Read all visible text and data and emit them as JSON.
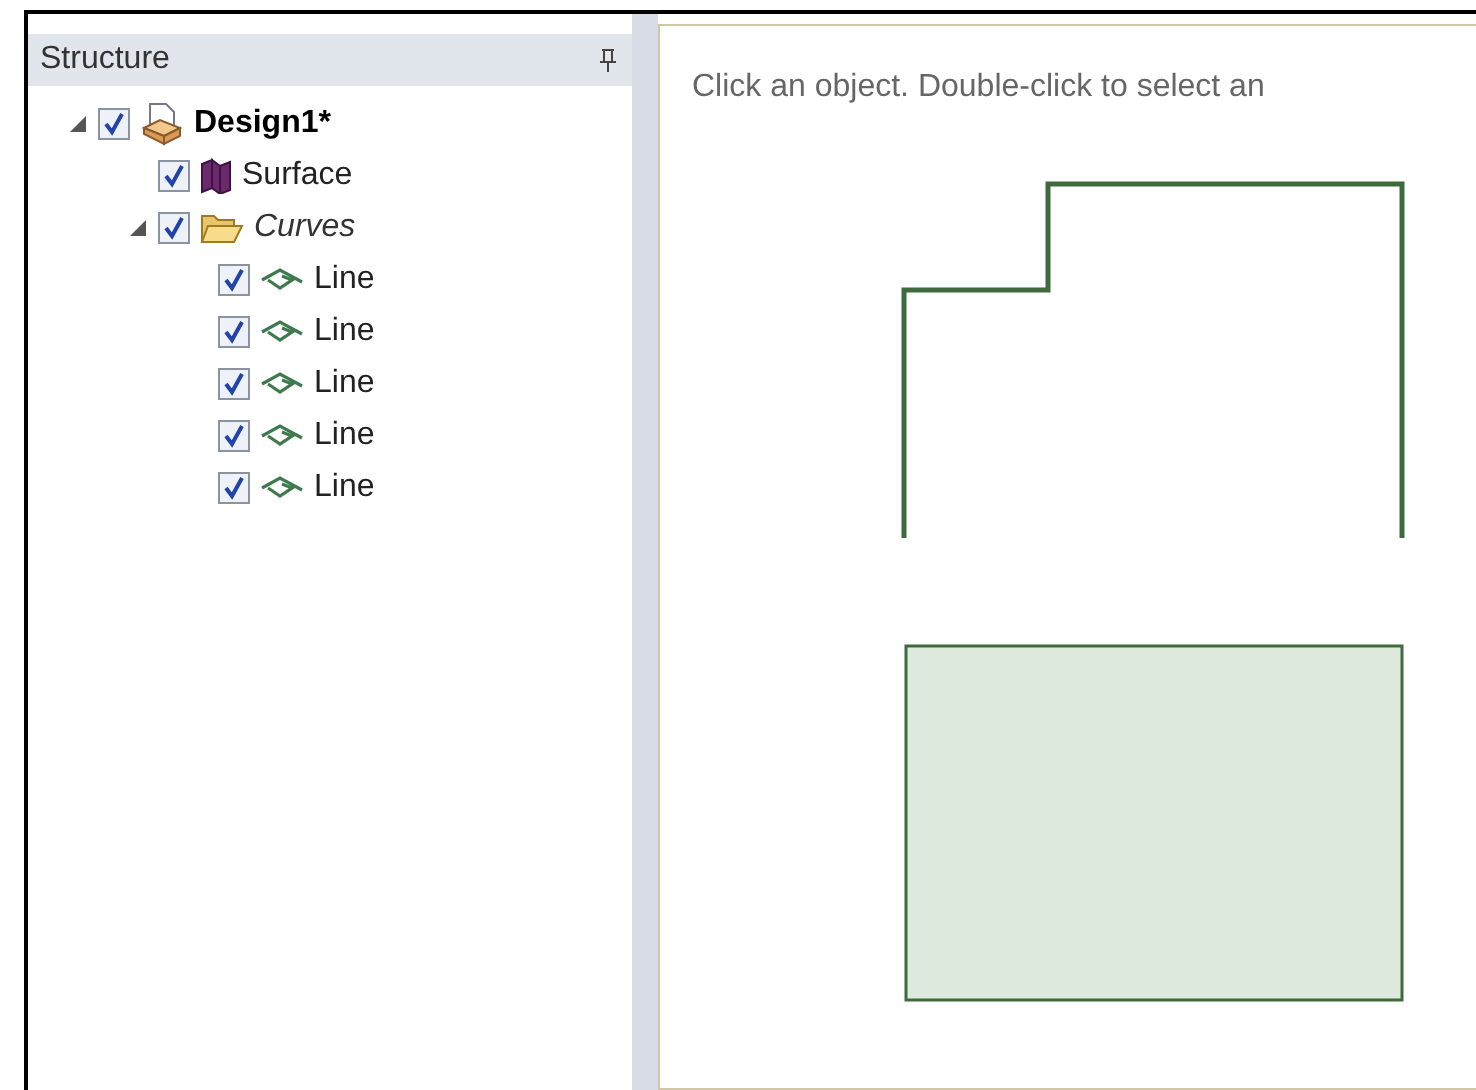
{
  "panel": {
    "title": "Structure"
  },
  "tree": [
    {
      "label": "Design1*",
      "kind": "design",
      "checked": true,
      "expanded": true,
      "children": [
        {
          "label": "Surface",
          "kind": "surface",
          "checked": true
        },
        {
          "label": "Curves",
          "kind": "folder",
          "checked": true,
          "expanded": true,
          "children": [
            {
              "label": "Line",
              "kind": "line",
              "checked": true
            },
            {
              "label": "Line",
              "kind": "line",
              "checked": true
            },
            {
              "label": "Line",
              "kind": "line",
              "checked": true
            },
            {
              "label": "Line",
              "kind": "line",
              "checked": true
            },
            {
              "label": "Line",
              "kind": "line",
              "checked": true
            }
          ]
        }
      ]
    }
  ],
  "canvas": {
    "hint": "Click an object. Double-click to select an"
  }
}
